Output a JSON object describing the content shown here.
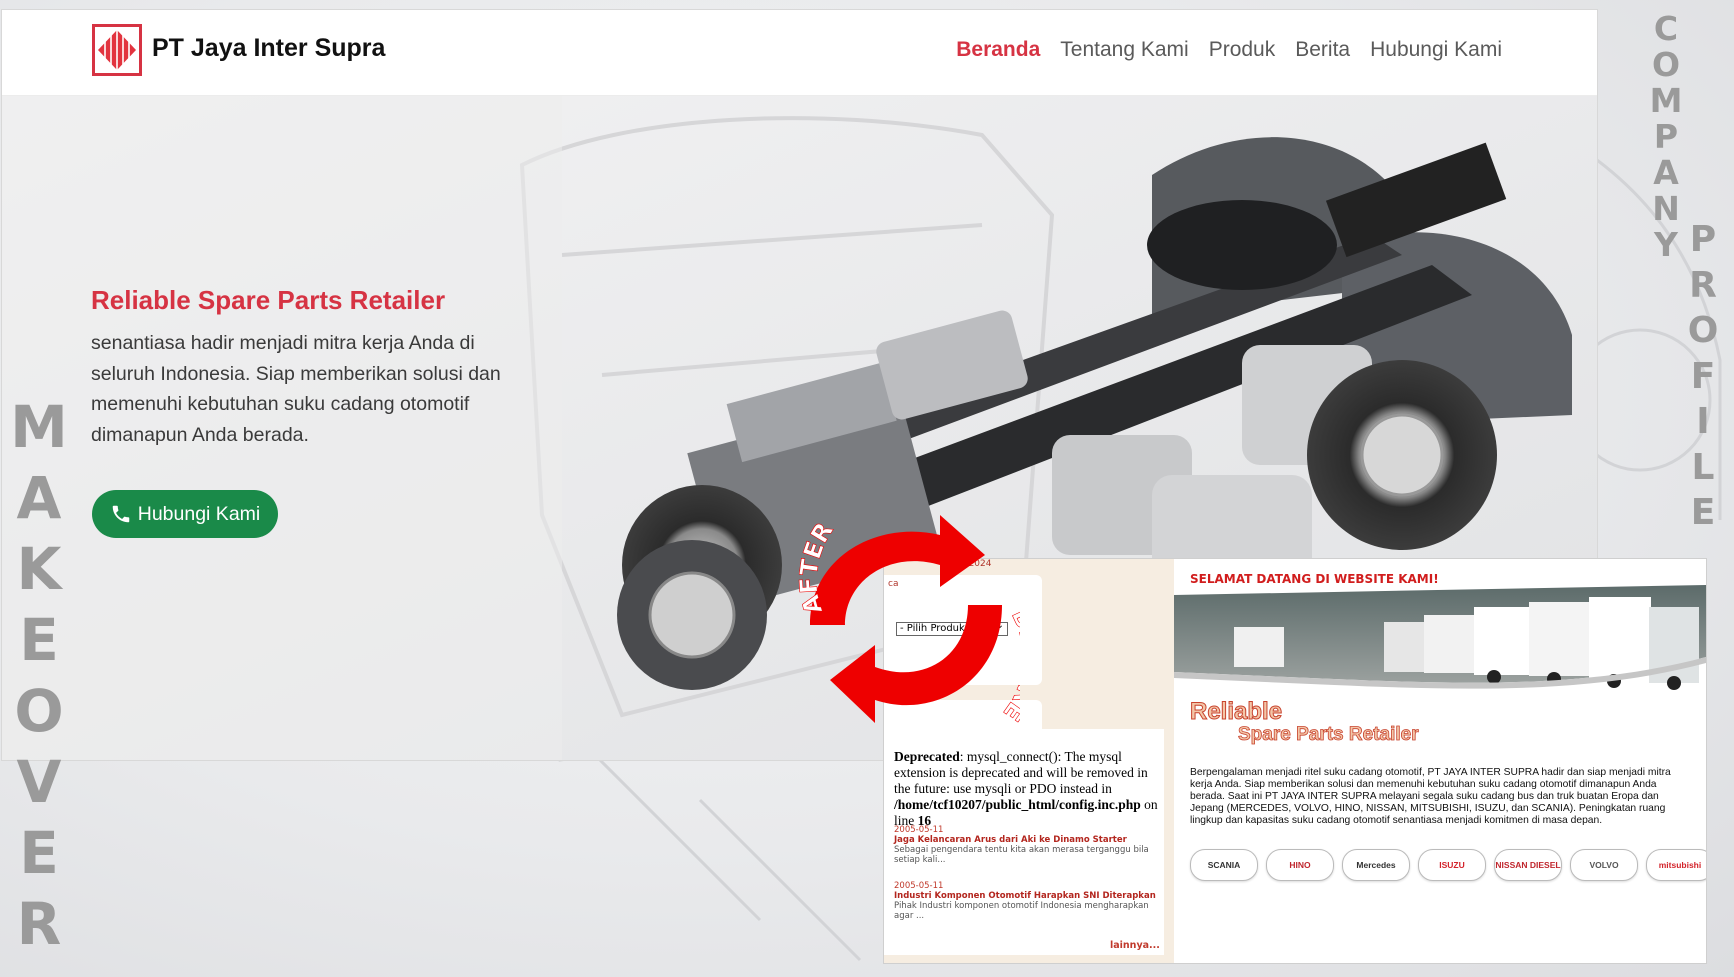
{
  "after": {
    "brand": {
      "name": "PT Jaya Inter Supra",
      "logo_icon": "diamond-logo-icon"
    },
    "nav": [
      {
        "label": "Beranda",
        "active": true
      },
      {
        "label": "Tentang Kami",
        "active": false
      },
      {
        "label": "Produk",
        "active": false
      },
      {
        "label": "Berita",
        "active": false
      },
      {
        "label": "Hubungi Kami",
        "active": false
      }
    ],
    "hero": {
      "title": "Reliable Spare Parts Retailer",
      "text": "senantiasa hadir menjadi mitra kerja Anda di seluruh Indonesia. Siap memberikan solusi dan memenuhi kebutuhan suku cadang otomotif dimanapun Anda berada.",
      "cta_label": "Hubungi Kami",
      "cta_icon": "phone-icon"
    },
    "colors": {
      "accent": "#d63343",
      "cta": "#1a8a49"
    }
  },
  "captions": {
    "left": "MAKEOVER",
    "right_top": "COMPANY",
    "right_bottom": "PROFILE",
    "arrow_after": "AFTER",
    "arrow_before": "BEFORE",
    "arrow_color": "#ee0000"
  },
  "before": {
    "date_fragment": "mber 2024",
    "tag_fragment": "ca",
    "select_value": "- Pilih Produk -",
    "deprecated": {
      "label": "Deprecated",
      "message": ": mysql_connect(): The mysql extension is deprecated and will be removed in the future: use mysqli or PDO instead in",
      "path": "/home/tcf10207/public_html/config.inc.php",
      "line_text": "on line",
      "line_no": "16"
    },
    "news": [
      {
        "date": "2005-05-11",
        "title": "Jaga Kelancaran Arus dari Aki ke Dinamo Starter",
        "excerpt": "Sebagai pengendara tentu kita akan merasa terganggu bila setiap kali..."
      },
      {
        "date": "2005-05-11",
        "title": "Industri Komponen Otomotif Harapkan SNI Diterapkan",
        "excerpt": "Pihak Industri komponen otomotif Indonesia mengharapkan agar ..."
      }
    ],
    "more_link": "lainnya...",
    "welcome": "SELAMAT DATANG DI WEBSITE KAMI!",
    "slogan_line1": "Reliable",
    "slogan_line2": "Spare Parts Retailer",
    "description": "Berpengalaman menjadi ritel suku cadang otomotif, PT JAYA INTER SUPRA hadir dan siap menjadi mitra kerja Anda. Siap memberikan solusi dan memenuhi kebutuhan suku cadang otomotif dimanapun Anda berada. Saat ini PT JAYA INTER SUPRA melayani segala suku cadang bus dan truk buatan Eropa dan Jepang (MERCEDES, VOLVO, HINO, NISSAN, MITSUBISHI, ISUZU, dan SCANIA). Peningkatan ruang lingkup dan kapasitas suku cadang otomotif senantiasa menjadi komitmen di masa depan.",
    "brands": [
      "SCANIA",
      "HINO",
      "Mercedes",
      "ISUZU",
      "NISSAN DIESEL",
      "VOLVO",
      "mitsubishi"
    ]
  }
}
